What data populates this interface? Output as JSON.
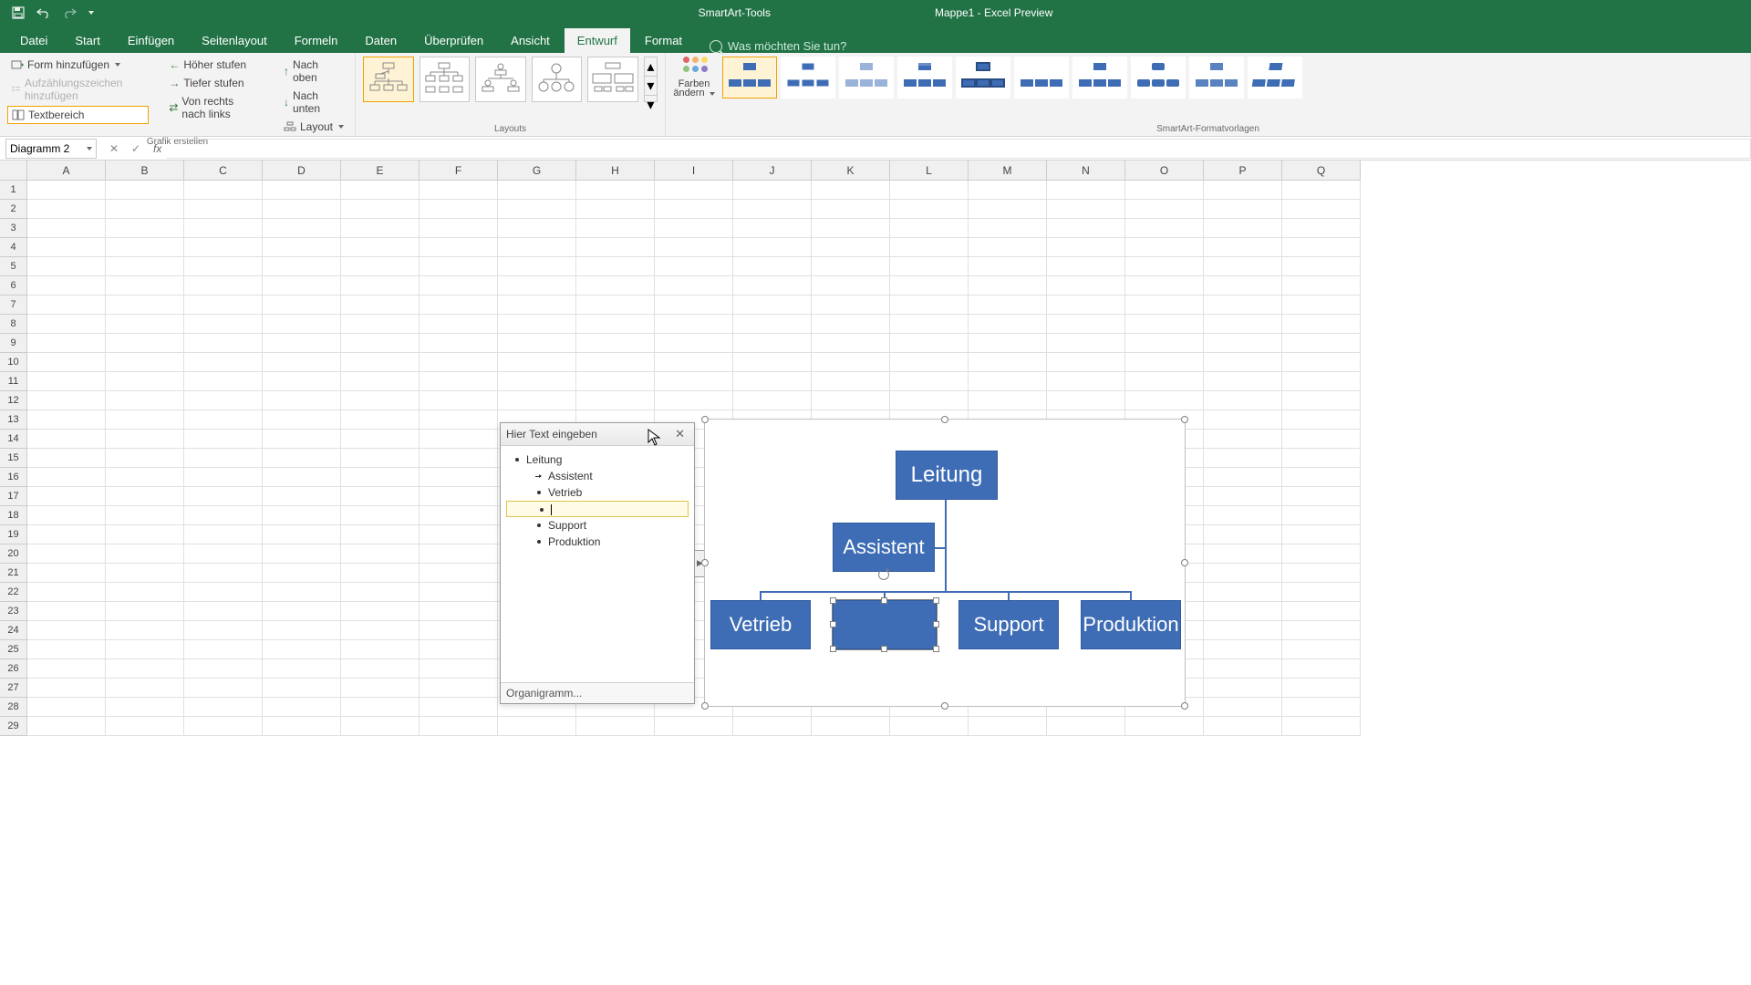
{
  "titlebar": {
    "tools_title": "SmartArt-Tools",
    "doc_title": "Mappe1  -  Excel Preview"
  },
  "tabs": {
    "items": [
      "Datei",
      "Start",
      "Einfügen",
      "Seitenlayout",
      "Formeln",
      "Daten",
      "Überprüfen",
      "Ansicht",
      "Entwurf",
      "Format"
    ],
    "active_index": 8,
    "tell_me": "Was möchten Sie tun?"
  },
  "ribbon": {
    "create": {
      "add_shape": "Form hinzufügen",
      "add_bullet": "Aufzählungszeichen hinzufügen",
      "text_pane": "Textbereich",
      "promote": "Höher stufen",
      "demote": "Tiefer stufen",
      "rtl": "Von rechts nach links",
      "move_up": "Nach oben",
      "move_down": "Nach unten",
      "layout_btn": "Layout",
      "group_label": "Grafik erstellen"
    },
    "layouts": {
      "group_label": "Layouts"
    },
    "colors": {
      "label": "Farben",
      "label2": "ändern"
    },
    "styles": {
      "group_label": "SmartArt-Formatvorlagen"
    }
  },
  "formula_bar": {
    "name_box": "Diagramm 2"
  },
  "columns": [
    "A",
    "B",
    "C",
    "D",
    "E",
    "F",
    "G",
    "H",
    "I",
    "J",
    "K",
    "L",
    "M",
    "N",
    "O",
    "P",
    "Q"
  ],
  "row_count": 29,
  "text_pane": {
    "title": "Hier Text eingeben",
    "items": [
      {
        "level": 1,
        "text": "Leitung",
        "kind": "normal"
      },
      {
        "level": 2,
        "text": "Assistent",
        "kind": "assistant"
      },
      {
        "level": 2,
        "text": "Vetrieb",
        "kind": "normal"
      },
      {
        "level": 2,
        "text": "",
        "kind": "editing"
      },
      {
        "level": 2,
        "text": "Support",
        "kind": "normal"
      },
      {
        "level": 2,
        "text": "Produktion",
        "kind": "normal"
      }
    ],
    "footer": "Organigramm..."
  },
  "chart_data": {
    "type": "org-chart",
    "title": "",
    "nodes": {
      "root": "Leitung",
      "assistant": "Assistent",
      "children": [
        "Vetrieb",
        "",
        "Support",
        "Produktion"
      ]
    }
  },
  "smartart": {
    "boxes": {
      "root": "Leitung",
      "assistant": "Assistent",
      "c1": "Vetrieb",
      "c2": "",
      "c3": "Support",
      "c4": "Produktion"
    }
  }
}
